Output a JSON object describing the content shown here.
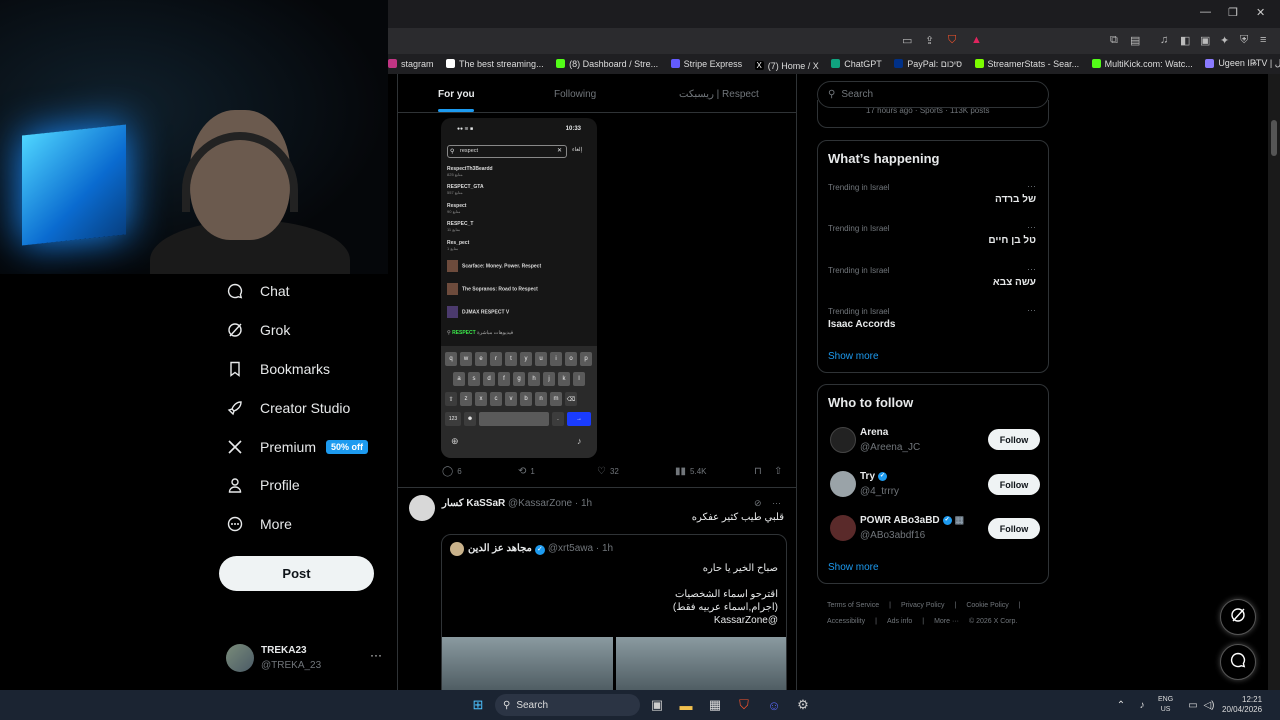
{
  "browser": {
    "window_controls": [
      "—",
      "❐",
      "✕"
    ],
    "bookmarks": [
      {
        "label": "stagram",
        "icon": "instagram-icon",
        "color": "#c13584"
      },
      {
        "label": "The best streaming...",
        "icon": "diamond-icon",
        "color": "#ffffff"
      },
      {
        "label": "(8) Dashboard / Stre...",
        "icon": "kick-icon",
        "color": "#53fc18"
      },
      {
        "label": "Stripe Express",
        "icon": "stripe-icon",
        "color": "#635bff"
      },
      {
        "label": "(7) Home / X",
        "icon": "x-icon",
        "color": "#ffffff"
      },
      {
        "label": "ChatGPT",
        "icon": "chatgpt-icon",
        "color": "#10a37f"
      },
      {
        "label": "PayPal: סיכום",
        "icon": "paypal-icon",
        "color": "#003087"
      },
      {
        "label": "StreamerStats - Sear...",
        "icon": "stats-icon",
        "color": "#7cfc00"
      },
      {
        "label": "MultiKick.com: Watc...",
        "icon": "mk-icon",
        "color": "#53fc18"
      },
      {
        "label": "Ugeen IPTV | تسجيل...",
        "icon": "iptv-icon",
        "color": "#8a7aff"
      }
    ]
  },
  "nav": {
    "items": [
      {
        "label": "Chat",
        "icon": "chat-icon"
      },
      {
        "label": "Grok",
        "icon": "grok-icon"
      },
      {
        "label": "Bookmarks",
        "icon": "bookmark-icon"
      },
      {
        "label": "Creator Studio",
        "icon": "rocket-icon"
      },
      {
        "label": "Premium",
        "icon": "x-logo-icon"
      },
      {
        "label": "Profile",
        "icon": "person-icon"
      },
      {
        "label": "More",
        "icon": "more-circle-icon"
      }
    ],
    "premium_badge": "50% off",
    "post_label": "Post",
    "account": {
      "name": "TREKA23",
      "handle": "@TREKA_23",
      "more": "···"
    }
  },
  "feed": {
    "tabs": [
      "For you",
      "Following",
      "ريسبكت | Respect"
    ],
    "phone": {
      "time": "10:33",
      "search_value": "respect",
      "cancel": "إلغاء",
      "results": [
        {
          "name": "RespectTh3Beardd",
          "sub": "825 متابع"
        },
        {
          "name": "RESPECT_GTA",
          "sub": "557 متابع"
        },
        {
          "name": "Respect",
          "sub": "90 متابع"
        },
        {
          "name": "RESPEC_T",
          "sub": "11 متابع"
        },
        {
          "name": "Res_pect",
          "sub": "1 متابع"
        }
      ],
      "suggestions": [
        "Scarface: Money. Power. Respect",
        "The Sopranos: Road to Respect",
        "DJMAX RESPECT V"
      ],
      "live_label": "RESPECT",
      "live_sub": "فيديوهات مباشرة",
      "keyboard": {
        "row1": [
          "q",
          "w",
          "e",
          "r",
          "t",
          "y",
          "u",
          "i",
          "o",
          "p"
        ],
        "row2": [
          "a",
          "s",
          "d",
          "f",
          "g",
          "h",
          "j",
          "k",
          "l"
        ],
        "row3": [
          "⇧",
          "z",
          "x",
          "c",
          "v",
          "b",
          "n",
          "m",
          "⌫"
        ],
        "num": "123"
      }
    },
    "actions": {
      "replies": "6",
      "reposts": "1",
      "likes": "32",
      "views": "5.4K"
    },
    "tweet2": {
      "name": "كسار KaSSaR",
      "handle": "@KassarZone · 1h",
      "text": "قلبي طيب كثير عفكره",
      "quote": {
        "name": "مجاهد عز الدين",
        "handle": "@xrt5awa · 1h",
        "lines": [
          "صباح الخير يا حاره",
          "اقترحو اسماء الشخصيات",
          "(اجرام,اسماء عربيه فقط)",
          "@KassarZone"
        ]
      }
    }
  },
  "right": {
    "search_placeholder": "Search",
    "prev_card_meta": "17 hours ago · Sports · 113K posts",
    "happening": {
      "title": "What’s happening",
      "trends": [
        {
          "meta": "Trending in Israel",
          "name": "של ברדה"
        },
        {
          "meta": "Trending in Israel",
          "name": "טל בן חיים"
        },
        {
          "meta": "Trending in Israel",
          "name": "עשה צבא"
        },
        {
          "meta": "Trending in Israel",
          "name": "Isaac Accords"
        }
      ],
      "show_more": "Show more"
    },
    "who_to_follow": {
      "title": "Who to follow",
      "accounts": [
        {
          "name": "Arena",
          "handle": "@Areena_JC",
          "verified": false
        },
        {
          "name": "Try",
          "handle": "@4_trrry",
          "verified": true
        },
        {
          "name": "POWR ABo3aBD",
          "handle": "@ABo3abdf16",
          "verified": true
        }
      ],
      "follow_label": "Follow",
      "show_more": "Show more"
    },
    "footer": [
      "Terms of Service",
      "|",
      "Privacy Policy",
      "|",
      "Cookie Policy",
      "|",
      "Accessibility",
      "|",
      "Ads info",
      "|",
      "More ···",
      "© 2026 X Corp."
    ]
  },
  "taskbar": {
    "search": "Search",
    "lang": "ENG",
    "region": "US",
    "time": "12:21",
    "date": "20/04/2026"
  }
}
